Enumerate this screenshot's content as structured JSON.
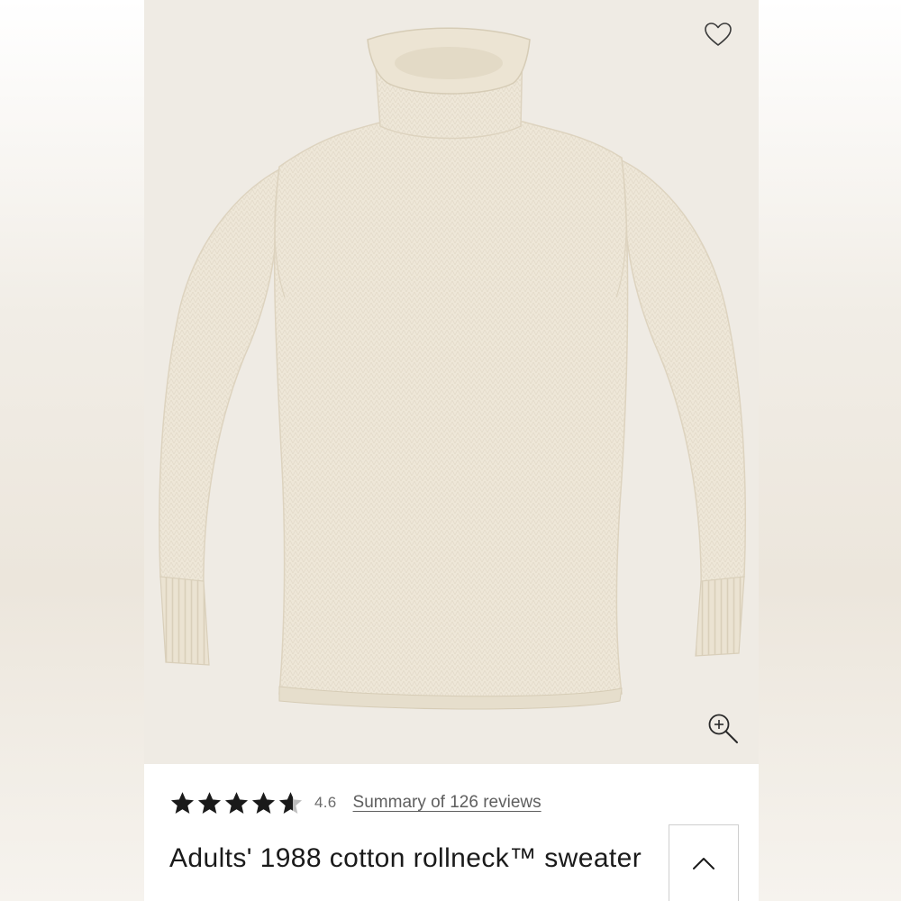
{
  "product": {
    "title": "Adults' 1988 cotton rollneck™ sweater",
    "rating": {
      "value_label": "4.6",
      "value": 4.6,
      "max": 5,
      "reviews_link": "Summary of 126 reviews"
    },
    "image": {
      "subject": "cream knit rollneck sweater",
      "background_color": "#efebe4",
      "knit_color": "#eee7d8"
    }
  },
  "icons": {
    "wishlist": "heart-icon",
    "zoom": "zoom-in-icon",
    "collapse": "chevron-up-icon",
    "star": "star-icon"
  },
  "colors": {
    "star_fill": "#1a1a1a",
    "star_empty": "#bdbdbd",
    "text_primary": "#1a1a1a",
    "text_secondary": "#5e5e5e"
  }
}
